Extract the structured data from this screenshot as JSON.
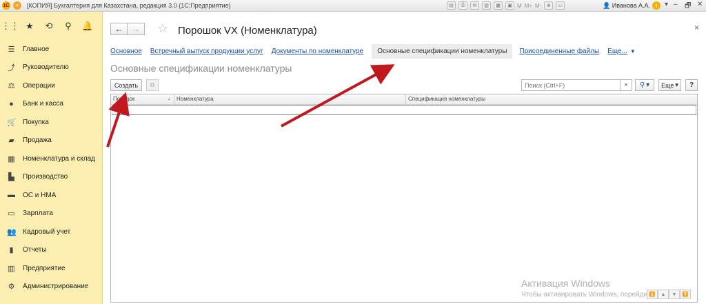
{
  "window": {
    "title": "[КОПИЯ] Бухгалтерия для Казахстана, редакция 3.0  (1С:Предприятие)",
    "logo_text": "1С",
    "tool_m": "M",
    "tool_m_plus": "M+",
    "tool_m_minus": "M-",
    "user": "Иванова А.А.",
    "info_glyph": "i",
    "minimize": "–",
    "restore": "🗗",
    "close": "✕"
  },
  "sidebar": {
    "items": [
      {
        "label": "Главное",
        "icon": "menu-lines-icon"
      },
      {
        "label": "Руководителю",
        "icon": "trend-icon"
      },
      {
        "label": "Операции",
        "icon": "operations-icon"
      },
      {
        "label": "Банк и касса",
        "icon": "bank-icon"
      },
      {
        "label": "Покупка",
        "icon": "cart-icon"
      },
      {
        "label": "Продажа",
        "icon": "sale-icon"
      },
      {
        "label": "Номенклатура и склад",
        "icon": "boxes-icon"
      },
      {
        "label": "Производство",
        "icon": "factory-icon"
      },
      {
        "label": "ОС и НМА",
        "icon": "truck-icon"
      },
      {
        "label": "Зарплата",
        "icon": "salary-icon"
      },
      {
        "label": "Кадровый учет",
        "icon": "people-icon"
      },
      {
        "label": "Отчеты",
        "icon": "chart-icon"
      },
      {
        "label": "Предприятие",
        "icon": "building-icon"
      },
      {
        "label": "Администрирование",
        "icon": "gear-icon"
      }
    ]
  },
  "document": {
    "back": "←",
    "forward": "→",
    "star": "☆",
    "title": "Порошок VX (Номенклатура)",
    "close": "×"
  },
  "tabs": {
    "main": "Основное",
    "services": "Встречный выпуск продукции услуг",
    "documents": "Документы по номенклатуре",
    "specs": "Основные спецификации номенклатуры",
    "files": "Присоединенные файлы",
    "more": "Еще...",
    "more_caret": "▼"
  },
  "section": {
    "title": "Основные спецификации номенклатуры"
  },
  "toolbar": {
    "create": "Создать",
    "search_placeholder": "Поиск (Ctrl+F)",
    "clear": "×",
    "search_glyph": "🔍",
    "more": "Еще",
    "caret": "▾",
    "help": "?"
  },
  "grid": {
    "columns": [
      "Порядок",
      "Номенклатура",
      "Спецификация номенклатуры"
    ],
    "sort_glyph": "↓"
  },
  "watermark": {
    "line1": "Активация Windows",
    "line2": "Чтобы активировать Windows, перейдите"
  },
  "colors": {
    "sidebar_bg": "#fbeeb0",
    "link": "#1a4fa8",
    "arrow": "#c0181e"
  }
}
